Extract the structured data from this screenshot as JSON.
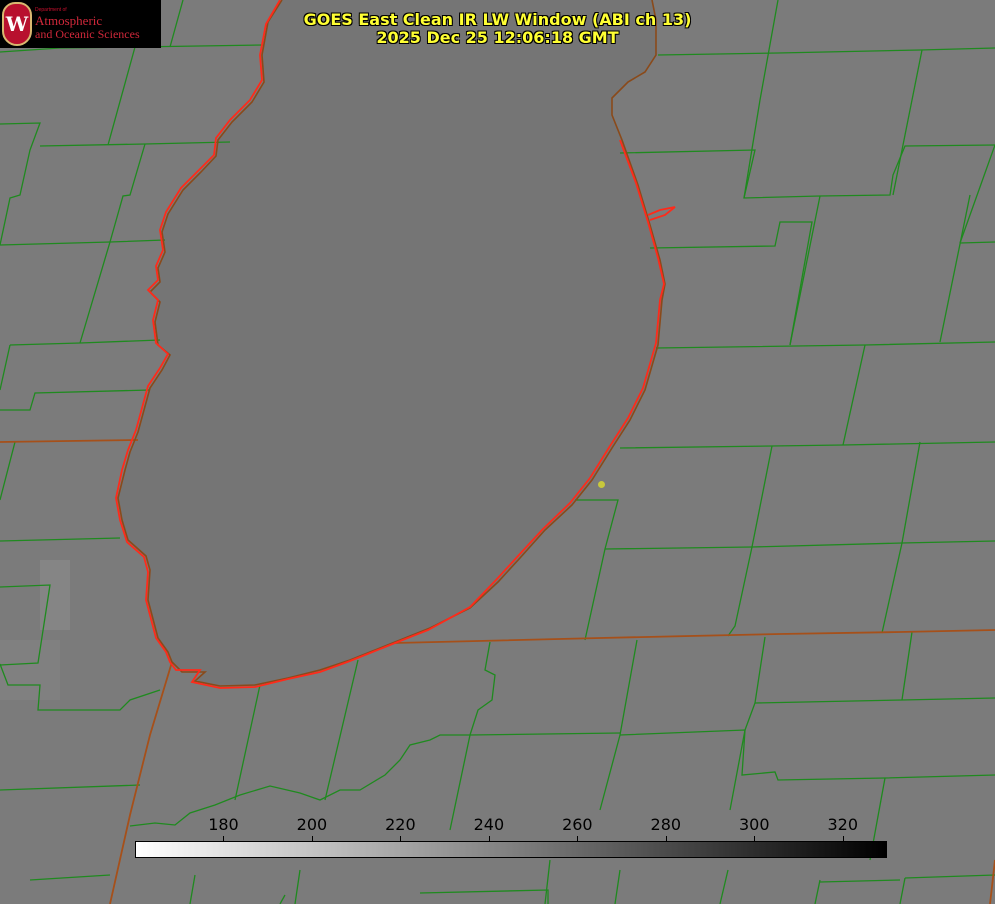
{
  "title": {
    "line1": "GOES East Clean IR LW Window (ABI ch 13)",
    "line2": "2025 Dec 25 12:06:18 GMT"
  },
  "logo": {
    "seal_letter": "W",
    "department": "Department of",
    "name_line1": "Atmospheric",
    "name_line2": "and Oceanic Sciences"
  },
  "colorbar": {
    "min_value": 160,
    "max_value": 330,
    "start_color": "#ffffff",
    "end_color": "#000000",
    "ticks": [
      "180",
      "200",
      "220",
      "240",
      "260",
      "280",
      "300",
      "320"
    ]
  },
  "map_colors": {
    "background": "#7b7b7b",
    "lake": "#757575",
    "county_lines": "#1f8a1f",
    "state_lines": "#a6501a",
    "coastline": "#ff2a1a",
    "marker": "#c8c83c"
  }
}
